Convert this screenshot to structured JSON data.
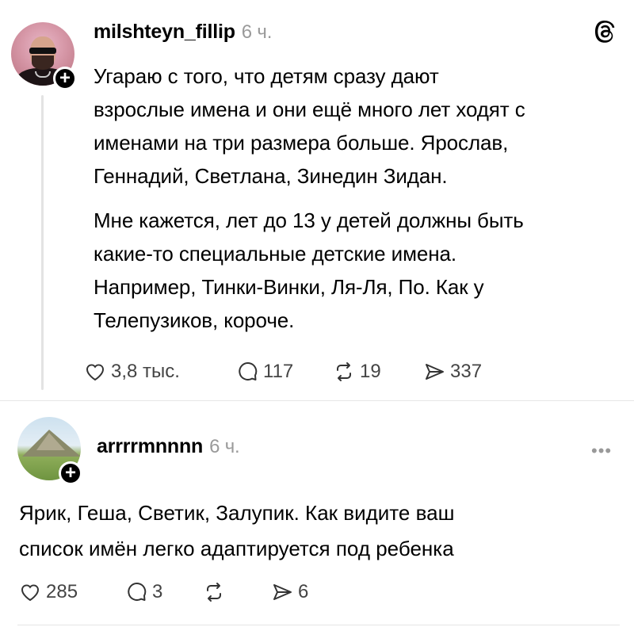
{
  "post1": {
    "username": "milshteyn_fillip",
    "time": "6 ч.",
    "paragraphs": [
      "Угараю с того, что детям сразу дают\nвзрослые имена и они ещё много лет ходят с\nименами на три размера больше. Ярослав,\nГеннадий, Светлана, Зинедин Зидан.",
      "Мне кажется, лет до 13 у детей должны быть\nкакие-то специальные детские имена.\nНапример, Тинки-Винки, Ля-Ля, По. Как у\nТелепузиков, короче."
    ],
    "actions": {
      "likes": "3,8 тыс.",
      "comments": "117",
      "reposts": "19",
      "shares": "337"
    }
  },
  "post2": {
    "username": "arrrrmnnnn",
    "time": "6 ч.",
    "text": "Ярик, Геша, Светик, Залупик. Как видите ваш\nсписок имён легко адаптируется под ребенка",
    "actions": {
      "likes": "285",
      "comments": "3",
      "shares": "6"
    },
    "more_label": "•••"
  },
  "icons": {
    "plus": "+",
    "logo": "threads-logo-icon"
  },
  "colors": {
    "text": "#000000",
    "secondary": "#9a9a9a",
    "divider": "#e6e6e6"
  }
}
